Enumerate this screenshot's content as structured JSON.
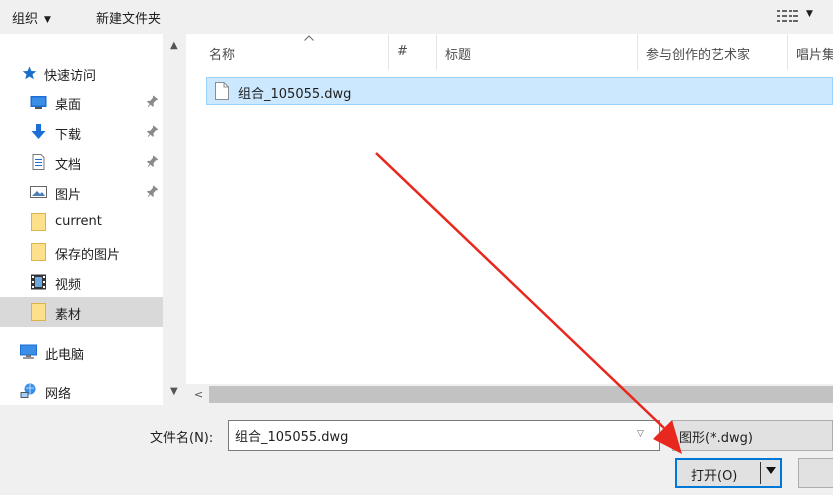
{
  "toolbar": {
    "organize_label": "组织",
    "new_folder_label": "新建文件夹"
  },
  "nav": {
    "quick_access": "快速访问",
    "items": [
      {
        "label": "桌面",
        "icon": "desktop-icon",
        "pinned": true
      },
      {
        "label": "下载",
        "icon": "download-icon",
        "pinned": true
      },
      {
        "label": "文档",
        "icon": "document-icon",
        "pinned": true
      },
      {
        "label": "图片",
        "icon": "pictures-icon",
        "pinned": true
      },
      {
        "label": "current",
        "icon": "folder-icon",
        "pinned": false
      },
      {
        "label": "保存的图片",
        "icon": "folder-icon",
        "pinned": false
      },
      {
        "label": "视频",
        "icon": "video-icon",
        "pinned": false
      },
      {
        "label": "素材",
        "icon": "folder-icon",
        "pinned": false,
        "selected": true
      }
    ],
    "this_pc": "此电脑",
    "network": "网络"
  },
  "columns": {
    "name": "名称",
    "number": "#",
    "title": "标题",
    "artists": "参与创作的艺术家",
    "album": "唱片集"
  },
  "files": [
    {
      "name": "组合_105055.dwg",
      "selected": true
    }
  ],
  "footer": {
    "filename_label": "文件名(N):",
    "filename_value": "组合_105055.dwg",
    "file_type": "图形(*.dwg)",
    "open_label": "打开(O)"
  },
  "colors": {
    "selection": "#cce8ff",
    "selection_border": "#99d1ff",
    "accent": "#0078d7",
    "arrow": "#e8281e"
  }
}
